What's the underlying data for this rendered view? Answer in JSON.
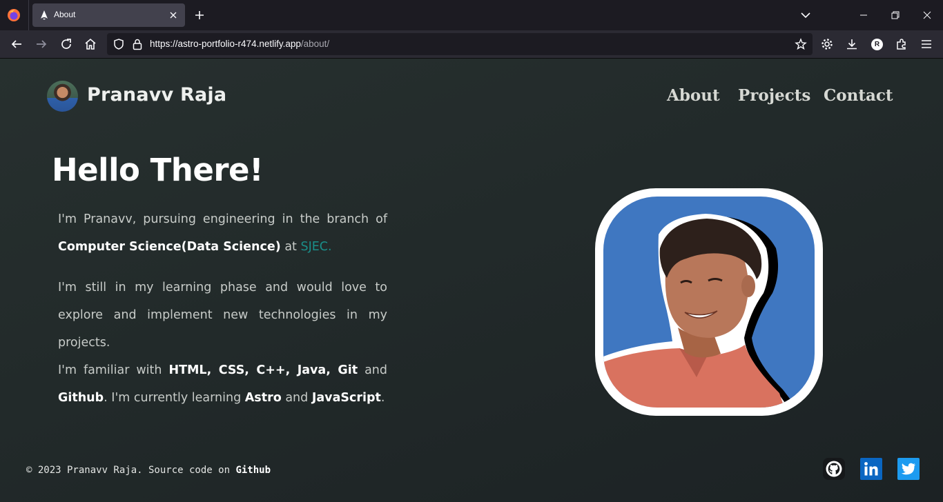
{
  "browser": {
    "tab_title": "About",
    "url_host": "https://astro-portfolio-r474.netlify.app",
    "url_path": "/about/",
    "profile_initial": "R"
  },
  "site": {
    "brand_name": "Pranavv Raja",
    "nav": [
      {
        "label": "About"
      },
      {
        "label": "Projects"
      },
      {
        "label": "Contact"
      }
    ]
  },
  "hero": {
    "title": "Hello There!",
    "p1": {
      "intro": "I'm Pranavv, pursuing engineering in the branch of",
      "branch": "Computer Science(Data Science)",
      "at": "at",
      "college": "SJEC."
    },
    "p2": "I'm still in my learning phase and would love to explore and implement new technologies in my projects.",
    "p3": {
      "familiar_prefix": "I'm familiar with",
      "skills": "HTML, CSS, C++, Java, Git",
      "and1": "and",
      "skill_last": "Github",
      "learning_prefix": ". I'm currently learning",
      "learn1": "Astro",
      "and2": "and",
      "learn2": "JavaScript",
      "end": "."
    }
  },
  "footer": {
    "copyright": "© 2023 Pranavv Raja. Source code on",
    "source_link": "Github",
    "social": [
      "github-icon",
      "linkedin-icon",
      "twitter-icon"
    ]
  },
  "colors": {
    "accent_link": "#1a8f8a",
    "portrait_bg": "#3f77c1",
    "linkedin": "#0a66c2",
    "twitter": "#1d9bf0"
  }
}
